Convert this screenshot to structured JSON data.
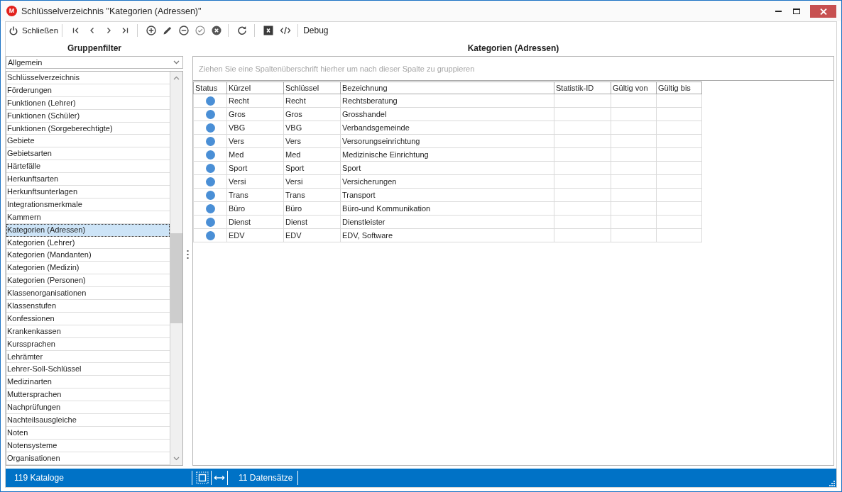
{
  "window": {
    "logo": "M",
    "title": "Schlüsselverzeichnis \"Kategorien (Adressen)\""
  },
  "toolbar": {
    "close_label": "Schließen",
    "debug_label": "Debug"
  },
  "group_filter": {
    "title": "Gruppenfilter",
    "dropdown": {
      "value": "Allgemein"
    },
    "items": [
      {
        "label": "Schlüsselverzeichnis",
        "selected": false
      },
      {
        "label": "Förderungen",
        "selected": false
      },
      {
        "label": "Funktionen (Lehrer)",
        "selected": false
      },
      {
        "label": "Funktionen (Schüler)",
        "selected": false
      },
      {
        "label": "Funktionen (Sorgeberechtigte)",
        "selected": false
      },
      {
        "label": "Gebiete",
        "selected": false
      },
      {
        "label": "Gebietsarten",
        "selected": false
      },
      {
        "label": "Härtefälle",
        "selected": false
      },
      {
        "label": "Herkunftsarten",
        "selected": false
      },
      {
        "label": "Herkunftsunterlagen",
        "selected": false
      },
      {
        "label": "Integrationsmerkmale",
        "selected": false
      },
      {
        "label": "Kammern",
        "selected": false
      },
      {
        "label": "Kategorien (Adressen)",
        "selected": true
      },
      {
        "label": "Kategorien (Lehrer)",
        "selected": false
      },
      {
        "label": "Kategorien (Mandanten)",
        "selected": false
      },
      {
        "label": "Kategorien (Medizin)",
        "selected": false
      },
      {
        "label": "Kategorien (Personen)",
        "selected": false
      },
      {
        "label": "Klassenorganisationen",
        "selected": false
      },
      {
        "label": "Klassenstufen",
        "selected": false
      },
      {
        "label": "Konfessionen",
        "selected": false
      },
      {
        "label": "Krankenkassen",
        "selected": false
      },
      {
        "label": "Kurssprachen",
        "selected": false
      },
      {
        "label": "Lehrämter",
        "selected": false
      },
      {
        "label": "Lehrer-Soll-Schlüssel",
        "selected": false
      },
      {
        "label": "Medizinarten",
        "selected": false
      },
      {
        "label": "Muttersprachen",
        "selected": false
      },
      {
        "label": "Nachprüfungen",
        "selected": false
      },
      {
        "label": "Nachteilsausgleiche",
        "selected": false
      },
      {
        "label": "Noten",
        "selected": false
      },
      {
        "label": "Notensysteme",
        "selected": false
      },
      {
        "label": "Organisationen",
        "selected": false
      }
    ]
  },
  "table_panel": {
    "title": "Kategorien (Adressen)",
    "group_hint": "Ziehen Sie eine Spaltenüberschrift hierher um nach dieser Spalte zu gruppieren",
    "columns": [
      "Status",
      "Kürzel",
      "Schlüssel",
      "Bezeichnung",
      "Statistik-ID",
      "Gültig von",
      "Gültig bis"
    ],
    "rows": [
      {
        "color": "#4a8fd6",
        "cells": [
          "",
          "Recht",
          "Recht",
          "Rechtsberatung"
        ]
      },
      {
        "color": "#4a8fd6",
        "cells": [
          "",
          "Gros",
          "Gros",
          "Grosshandel"
        ]
      },
      {
        "color": "#4a8fd6",
        "cells": [
          "",
          "VBG",
          "VBG",
          "Verbandsgemeinde"
        ]
      },
      {
        "color": "#4a8fd6",
        "cells": [
          "",
          "Vers",
          "Vers",
          "Versorungseinrichtung"
        ]
      },
      {
        "color": "#4a8fd6",
        "cells": [
          "",
          "Med",
          "Med",
          "Medizinische Einrichtung"
        ]
      },
      {
        "color": "#4a8fd6",
        "cells": [
          "",
          "Sport",
          "Sport",
          "Sport"
        ]
      },
      {
        "color": "#4a8fd6",
        "cells": [
          "",
          "Versi",
          "Versi",
          "Versicherungen"
        ]
      },
      {
        "color": "#4a8fd6",
        "cells": [
          "",
          "Trans",
          "Trans",
          "Transport"
        ]
      },
      {
        "color": "#4a8fd6",
        "cells": [
          "",
          "Büro",
          "Büro",
          "Büro-und Kommunikation"
        ]
      },
      {
        "color": "#4a8fd6",
        "cells": [
          "",
          "Dienst",
          "Dienst",
          "Dienstleister"
        ]
      },
      {
        "color": "#4a8fd6",
        "cells": [
          "",
          "EDV",
          "EDV",
          "EDV, Software"
        ]
      }
    ]
  },
  "status_bar": {
    "catalogs": "119 Kataloge",
    "records": "11 Datensätze"
  }
}
